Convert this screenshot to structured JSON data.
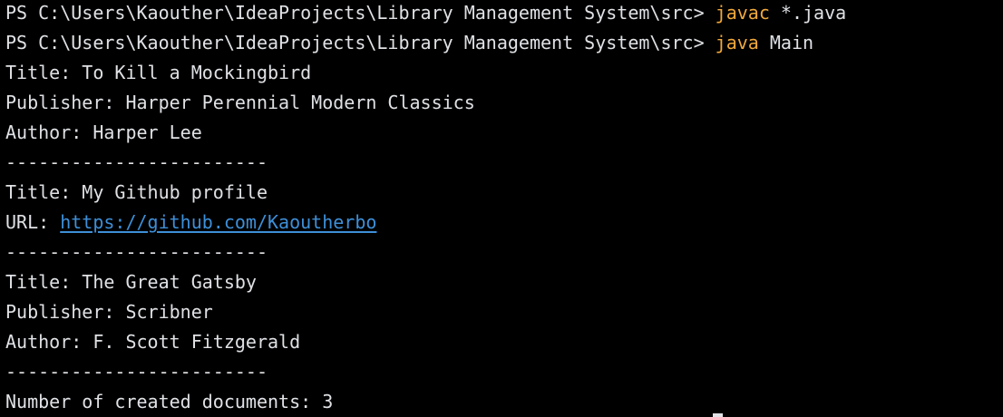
{
  "terminal": {
    "prompt1": {
      "prompt": "PS C:\\Users\\Kaouther\\IdeaProjects\\Library Management System\\src> ",
      "command": "javac",
      "args": " *.java"
    },
    "prompt2": {
      "prompt": "PS C:\\Users\\Kaouther\\IdeaProjects\\Library Management System\\src> ",
      "command": "java",
      "args": " Main"
    },
    "book1": {
      "title": "Title: To Kill a Mockingbird",
      "publisher": "Publisher: Harper Perennial Modern Classics",
      "author": "Author: Harper Lee"
    },
    "separator": "------------------------",
    "profile": {
      "title": "Title: My Github profile",
      "url_label": "URL: ",
      "url": "https://github.com/Kaoutherbo"
    },
    "book2": {
      "title": "Title: The Great Gatsby",
      "publisher": "Publisher: Scribner",
      "author": "Author: F. Scott Fitzgerald"
    },
    "summary": "Number of created documents: 3",
    "colors": {
      "background": "#000000",
      "text": "#dfe1e5",
      "command": "#f0a83c",
      "link": "#3e8fd8"
    }
  }
}
